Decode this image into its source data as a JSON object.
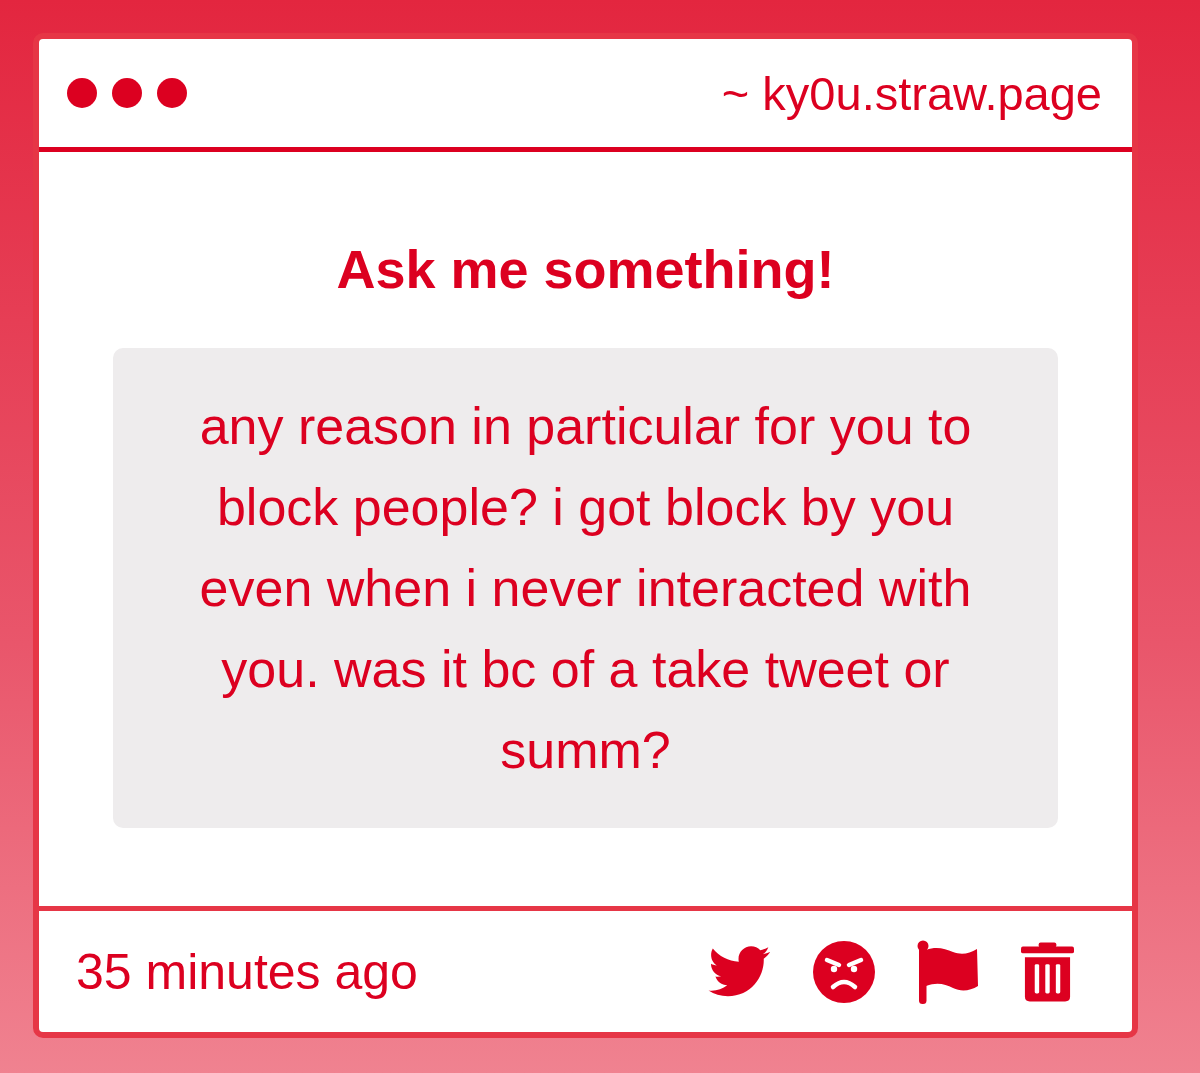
{
  "header": {
    "url": "~ ky0u.straw.page"
  },
  "title": "Ask me something!",
  "question": "any reason in particular for you to block people? i got block by you even when i never interacted with you. was it bc of a take tweet or summ?",
  "footer": {
    "time": "35 minutes ago"
  }
}
